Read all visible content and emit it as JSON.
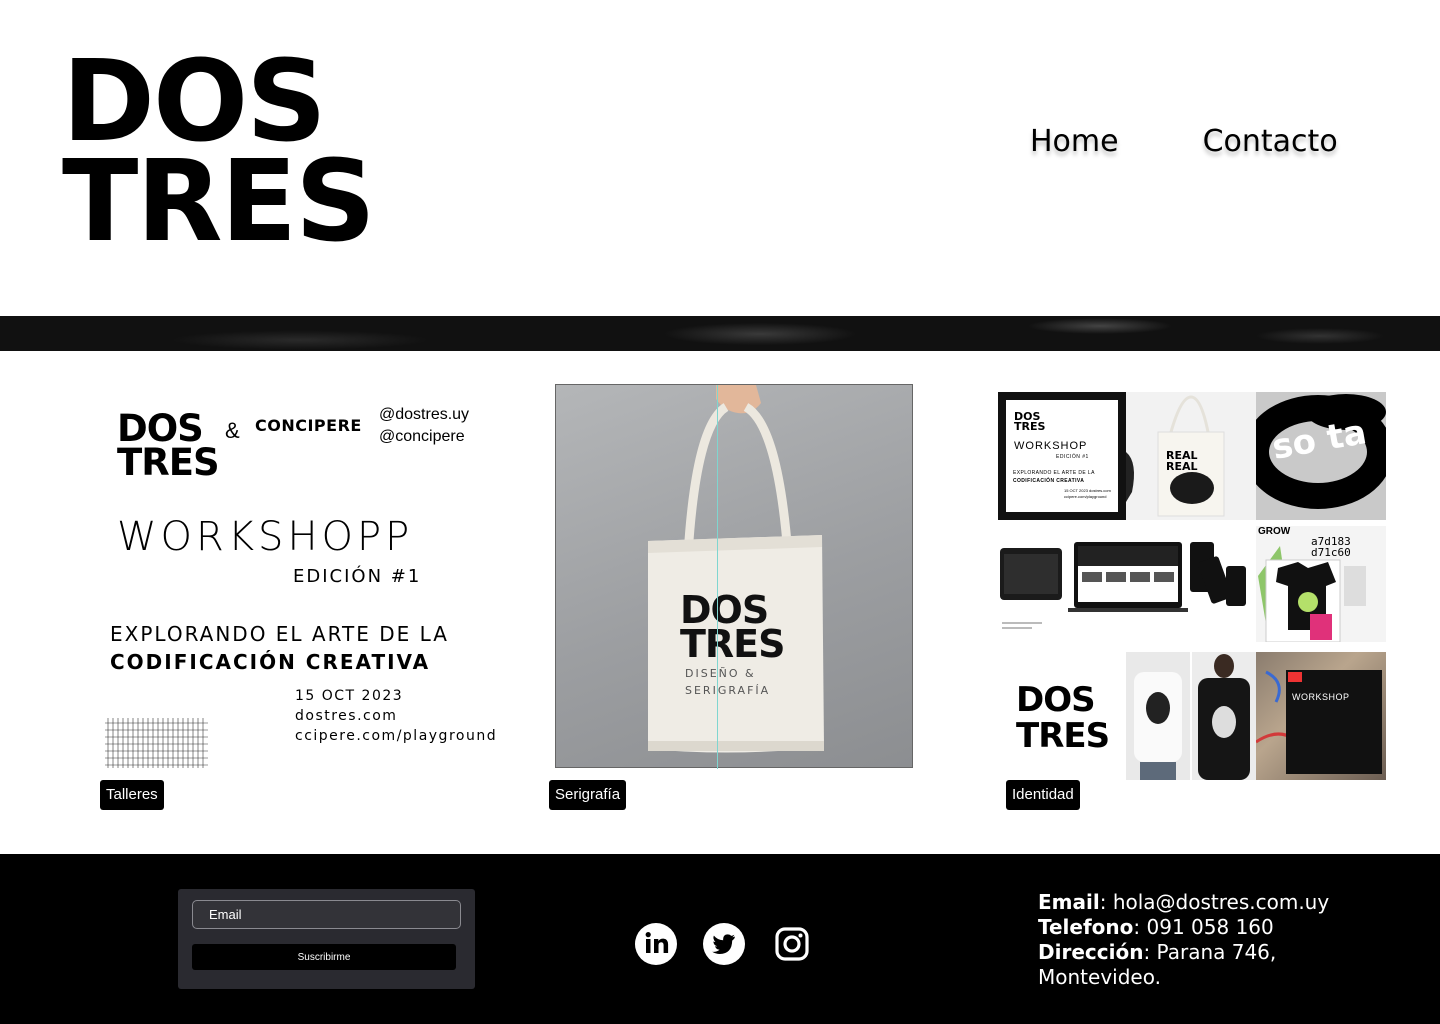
{
  "header": {
    "logo_line1": "DOS",
    "logo_line2": "TRES",
    "nav": [
      {
        "label": "Home"
      },
      {
        "label": "Contacto"
      }
    ]
  },
  "gallery": [
    {
      "tag": "Talleres",
      "poster": {
        "logo_line1": "DOS",
        "logo_line2": "TRES",
        "amp": "&",
        "partner": "CONCIPERE",
        "handle1": "@dostres.uy",
        "handle2": "@concipere",
        "title": "WORKSHOPP",
        "edition": "EDICIÓN #1",
        "line1": "EXPLORANDO EL ARTE DE LA",
        "line2": "CODIFICACIÓN CREATIVA",
        "date": "15 OCT 2023",
        "site1": "dostres.com",
        "site2": "ccipere.com/playground"
      }
    },
    {
      "tag": "Serigrafía",
      "bag": {
        "logo_line1": "DOS",
        "logo_line2": "TRES",
        "sub1": "DISEÑO &",
        "sub2": "SERIGRAFÍA"
      }
    },
    {
      "tag": "Identidad",
      "collage": {
        "mini_logo1": "DOS",
        "mini_logo2": "TRES",
        "mini_work": "WORKSHOP",
        "mini_ed": "EDICIÓN #1",
        "mini_expl": "EXPLORANDO EL ARTE DE LA",
        "mini_cod": "CODIFICACIÓN CREATIVA",
        "mini_info": "15 OCT 2023 dostres.com ccipere.com/playground",
        "ring_text": "so ta",
        "code1": "a7d183",
        "code2": "d71c60",
        "grow": "GROW",
        "big_logo1": "DOS",
        "big_logo2": "TRES",
        "shirt_text": "REAL REAL"
      }
    }
  ],
  "footer": {
    "email_placeholder": "Email",
    "subscribe_label": "Suscribirme",
    "social": [
      "linkedin-icon",
      "twitter-icon",
      "instagram-icon"
    ],
    "contact": {
      "email_label": "Email",
      "email_value": "hola@dostres.com.uy",
      "phone_label": "Telefono",
      "phone_value": "091 058 160",
      "address_label": "Dirección",
      "address_value": "Parana 746, Montevideo."
    }
  }
}
